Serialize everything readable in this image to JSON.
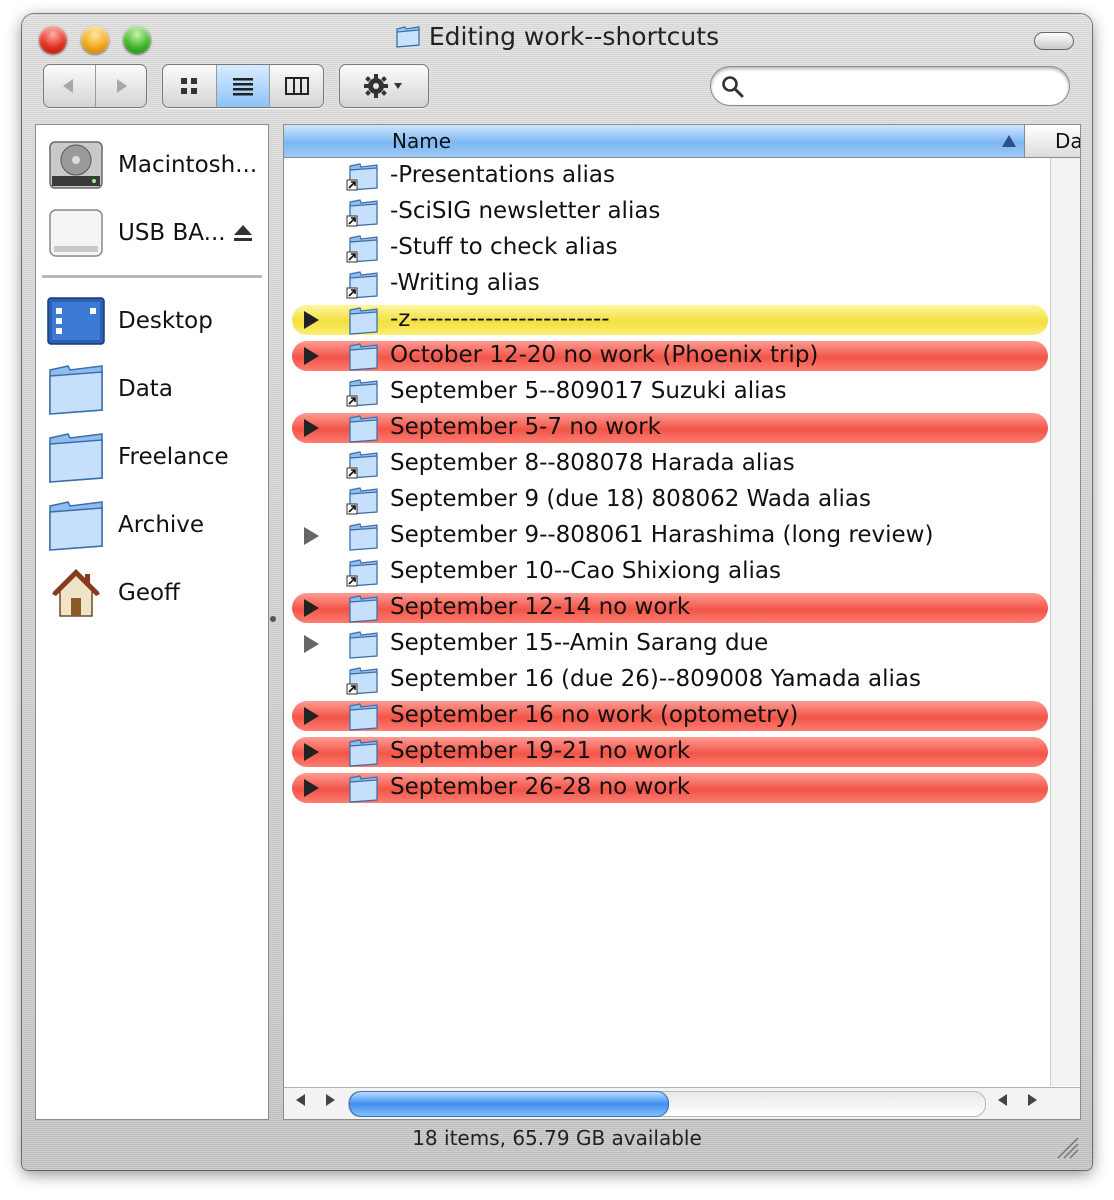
{
  "window": {
    "title": "Editing work--shortcuts",
    "status": "18 items, 65.79 GB available"
  },
  "toolbar": {
    "back_icon": "back-arrow-icon",
    "forward_icon": "forward-arrow-icon",
    "views": [
      "icon-view-icon",
      "list-view-icon",
      "column-view-icon"
    ],
    "active_view": "list",
    "action_icon": "gear-icon",
    "search_value": ""
  },
  "sidebar": {
    "devices": [
      {
        "label": "Macintosh...",
        "icon": "hard-disk-icon"
      },
      {
        "label": "USB BA...",
        "icon": "usb-drive-icon",
        "ejectable": true
      }
    ],
    "places": [
      {
        "label": "Desktop",
        "icon": "desktop-icon"
      },
      {
        "label": "Data",
        "icon": "folder-icon"
      },
      {
        "label": "Freelance",
        "icon": "folder-icon"
      },
      {
        "label": "Archive",
        "icon": "folder-icon"
      },
      {
        "label": "Geoff",
        "icon": "home-icon"
      }
    ]
  },
  "list": {
    "columns": [
      "Name",
      "Da"
    ],
    "sort_column": "Name",
    "rows": [
      {
        "name": "-Presentations alias",
        "alias": true,
        "expandable": false,
        "label": "none"
      },
      {
        "name": "-SciSIG newsletter alias",
        "alias": true,
        "expandable": false,
        "label": "none"
      },
      {
        "name": "-Stuff to check alias",
        "alias": true,
        "expandable": false,
        "label": "none"
      },
      {
        "name": "-Writing alias",
        "alias": true,
        "expandable": false,
        "label": "none"
      },
      {
        "name": "-z------------------------",
        "alias": false,
        "expandable": true,
        "label": "yellow"
      },
      {
        "name": "October 12-20 no work (Phoenix trip)",
        "alias": false,
        "expandable": true,
        "label": "red"
      },
      {
        "name": "September 5--809017 Suzuki alias",
        "alias": true,
        "expandable": false,
        "label": "none"
      },
      {
        "name": "September 5-7 no work",
        "alias": false,
        "expandable": true,
        "label": "red"
      },
      {
        "name": "September 8--808078 Harada alias",
        "alias": true,
        "expandable": false,
        "label": "none"
      },
      {
        "name": "September 9 (due 18) 808062 Wada alias",
        "alias": true,
        "expandable": false,
        "label": "none"
      },
      {
        "name": "September 9--808061 Harashima (long review)",
        "alias": false,
        "expandable": true,
        "label": "none"
      },
      {
        "name": "September 10--Cao Shixiong alias",
        "alias": true,
        "expandable": false,
        "label": "none"
      },
      {
        "name": "September 12-14 no work",
        "alias": false,
        "expandable": true,
        "label": "red"
      },
      {
        "name": "September 15--Amin Sarang due",
        "alias": false,
        "expandable": true,
        "label": "none"
      },
      {
        "name": "September 16 (due 26)--809008 Yamada alias",
        "alias": true,
        "expandable": false,
        "label": "none"
      },
      {
        "name": "September 16 no work (optometry)",
        "alias": false,
        "expandable": true,
        "label": "red"
      },
      {
        "name": "September 19-21 no work",
        "alias": false,
        "expandable": true,
        "label": "red"
      },
      {
        "name": "September 26-28 no work",
        "alias": false,
        "expandable": true,
        "label": "red"
      }
    ]
  },
  "colors": {
    "label_red": "#f25548",
    "label_yellow": "#f2e040",
    "accent_blue": "#7db7f2"
  }
}
